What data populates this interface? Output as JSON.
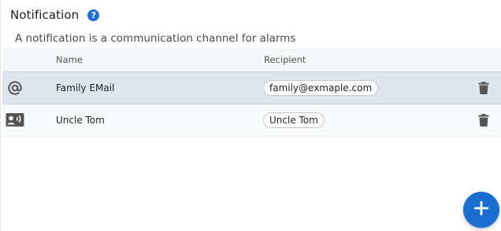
{
  "header": {
    "title": "Notification",
    "help_icon": "help-circle-icon",
    "help_glyph": "?"
  },
  "subtitle": "A notification is a communication channel for alarms",
  "table": {
    "columns": {
      "name": "Name",
      "recipient": "Recipient"
    },
    "rows": [
      {
        "icon": "at-sign-icon",
        "name": "Family EMail",
        "recipient": "family@exmaple.com",
        "selected": true
      },
      {
        "icon": "contact-card-icon",
        "name": "Uncle Tom",
        "recipient": "Uncle Tom",
        "selected": false
      }
    ],
    "delete_icon": "trash-icon"
  },
  "fab": {
    "icon": "plus-icon"
  },
  "colors": {
    "accent": "#1a6fd1",
    "selected_row": "#dce6ec",
    "header_bg": "#f6f7f9",
    "icon_gray": "#555555"
  }
}
